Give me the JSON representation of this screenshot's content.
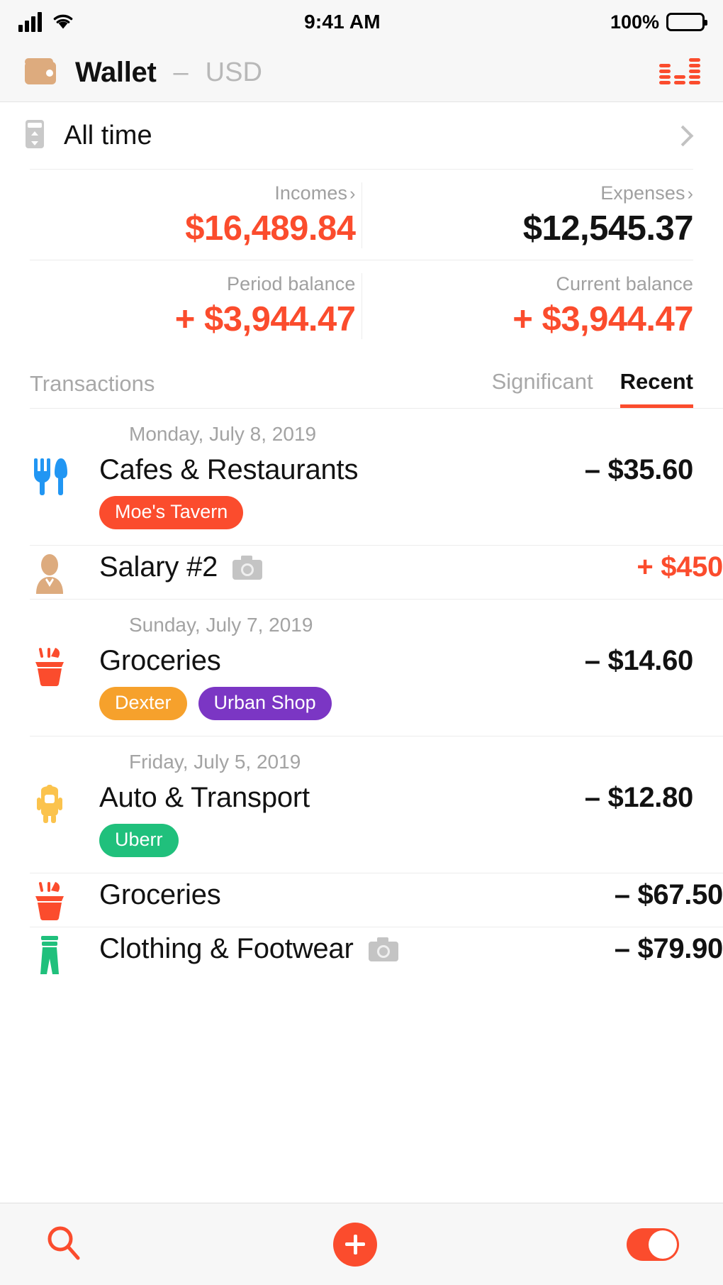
{
  "status_bar": {
    "time": "9:41 AM",
    "battery_percent": "100%",
    "signal_icon": "signal-bars-icon",
    "wifi_icon": "wifi-icon",
    "battery_icon": "battery-icon"
  },
  "header": {
    "wallet_icon": "wallet-icon",
    "title": "Wallet",
    "dash": "–",
    "currency": "USD",
    "chart_icon": "bar-chart-icon"
  },
  "period": {
    "calendar_icon": "calendar-icon",
    "label": "All time",
    "chevron": "chevron-right-icon"
  },
  "summary": {
    "incomes_label": "Incomes",
    "incomes_value": "$16,489.84",
    "expenses_label": "Expenses",
    "expenses_value": "$12,545.37",
    "period_balance_label": "Period balance",
    "period_balance_value": "+ $3,944.47",
    "current_balance_label": "Current balance",
    "current_balance_value": "+ $3,944.47",
    "caret": "›"
  },
  "transactions": {
    "section_title": "Transactions",
    "tabs": [
      {
        "label": "Significant",
        "active": false
      },
      {
        "label": "Recent",
        "active": true
      }
    ],
    "groups": [
      {
        "date": "Monday, July 8, 2019",
        "items": [
          {
            "icon": "cutlery-icon",
            "name": "Cafes & Restaurants",
            "amount": "– $35.60",
            "amount_sign": "neg",
            "has_photo": false,
            "tags": [
              {
                "label": "Moe's Tavern",
                "color": "#fb4c2d"
              }
            ]
          },
          {
            "icon": "person-icon",
            "name": "Salary #2",
            "amount": "+ $450",
            "amount_sign": "pos",
            "has_photo": true,
            "tags": []
          }
        ]
      },
      {
        "date": "Sunday, July 7, 2019",
        "items": [
          {
            "icon": "grocery-basket-icon",
            "name": "Groceries",
            "amount": "– $14.60",
            "amount_sign": "neg",
            "has_photo": false,
            "tags": [
              {
                "label": "Dexter",
                "color": "#f6a12c"
              },
              {
                "label": "Urban Shop",
                "color": "#7b36c4"
              }
            ]
          }
        ]
      },
      {
        "date": "Friday, July 5, 2019",
        "items": [
          {
            "icon": "car-icon",
            "name": "Auto & Transport",
            "amount": "– $12.80",
            "amount_sign": "neg",
            "has_photo": false,
            "tags": [
              {
                "label": "Uberr",
                "color": "#20c07c"
              }
            ]
          },
          {
            "icon": "grocery-basket-icon",
            "name": "Groceries",
            "amount": "– $67.50",
            "amount_sign": "neg",
            "has_photo": false,
            "tags": []
          },
          {
            "icon": "clothing-icon",
            "name": "Clothing & Footwear",
            "amount": "– $79.90",
            "amount_sign": "neg",
            "has_photo": true,
            "tags": []
          }
        ]
      }
    ]
  },
  "bottom_bar": {
    "search_icon": "search-icon",
    "add_icon": "add-transaction-icon",
    "toggle_icon": "toggle-switch-on-icon"
  },
  "colors": {
    "accent": "#fb4c2d",
    "wallet_tan": "#ddab7e",
    "bg": "#ffffff",
    "chrome": "#f7f7f7"
  }
}
